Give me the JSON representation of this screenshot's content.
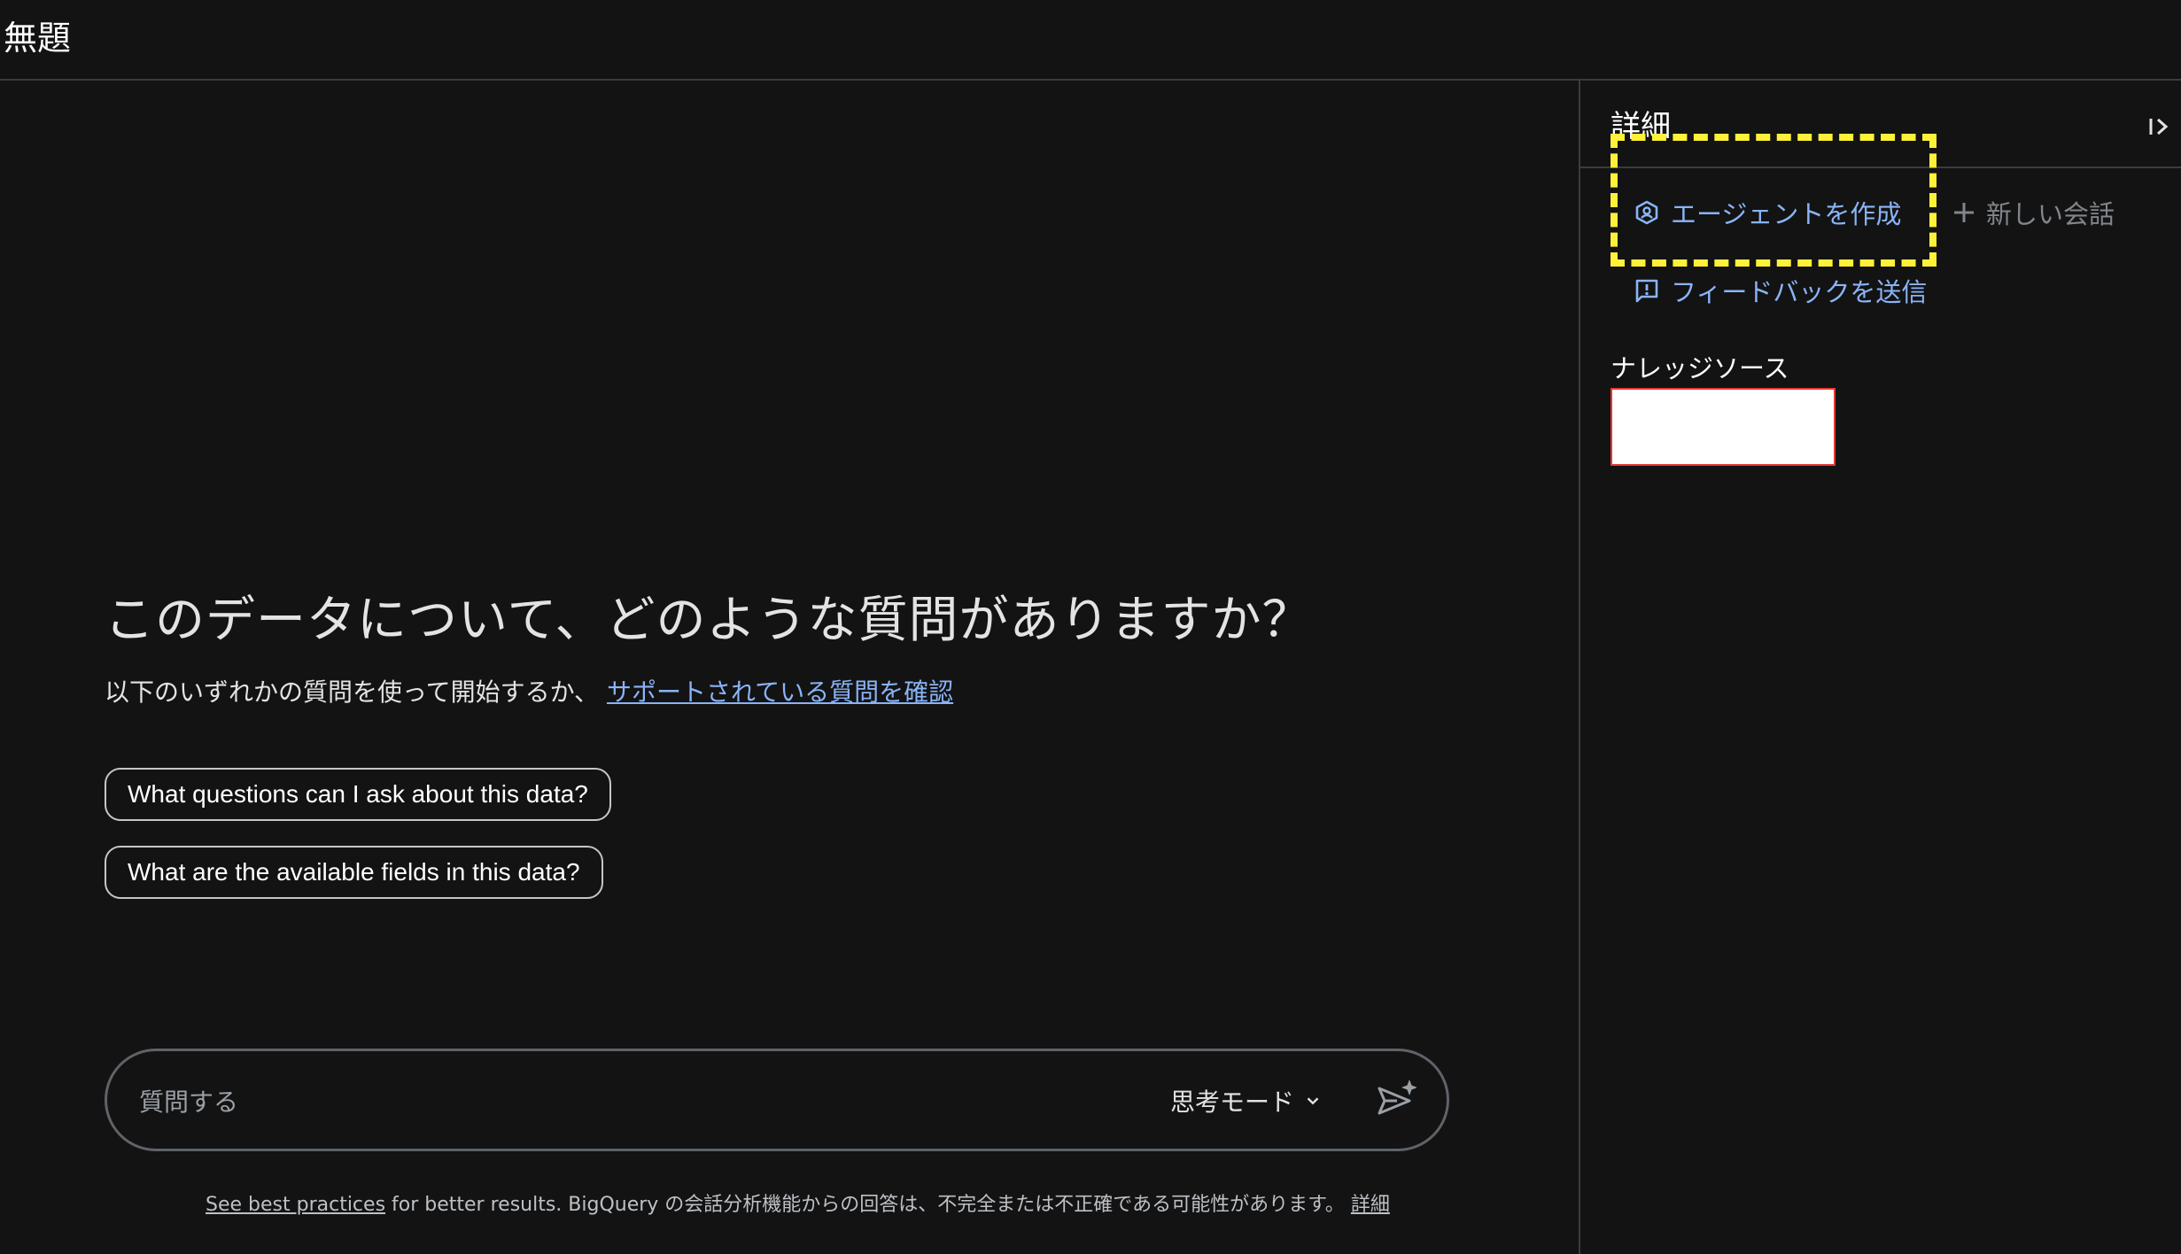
{
  "window": {
    "title": "無題"
  },
  "main": {
    "headline": "このデータについて、どのような質問がありますか？",
    "intro_text": "以下のいずれかの質問を使って開始するか、",
    "intro_link": "サポートされている質問を確認",
    "suggestions": [
      "What questions can I ask about this data?",
      "What are the available fields in this data?"
    ],
    "composer": {
      "placeholder": "質問する",
      "mode_label": "思考モード"
    },
    "footer": {
      "link_text": "See best practices",
      "text": " for better results. BigQuery の会話分析機能からの回答は、不完全または不正確である可能性があります。 ",
      "details_link": "詳細"
    }
  },
  "sidebar": {
    "title": "詳細",
    "actions": {
      "create_agent": "エージェントを作成",
      "new_conversation": "新しい会話",
      "send_feedback": "フィードバックを送信"
    },
    "knowledge_sources_label": "ナレッジソース"
  },
  "colors": {
    "background": "#131313",
    "link": "#8ab4f8",
    "highlight": "#fff13a",
    "redacted_border": "#e53935"
  }
}
